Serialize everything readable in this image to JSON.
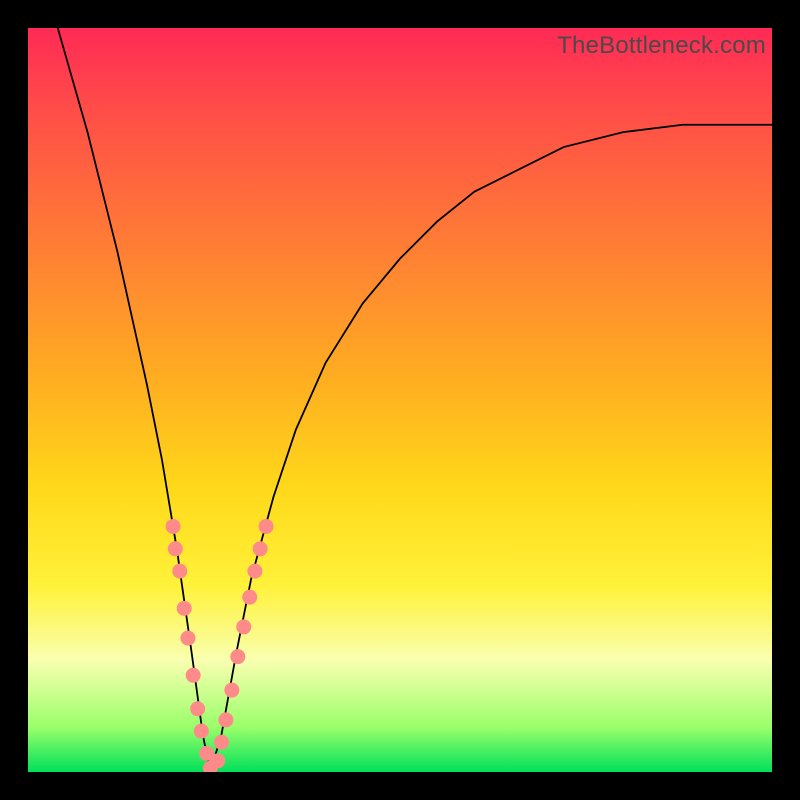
{
  "watermark": "TheBottleneck.com",
  "chart_data": {
    "type": "line",
    "title": "",
    "xlabel": "",
    "ylabel": "",
    "xlim": [
      0,
      1
    ],
    "ylim": [
      0,
      1
    ],
    "curve": {
      "name": "bottleneck-curve",
      "color": "#000000",
      "x": [
        0.04,
        0.06,
        0.08,
        0.1,
        0.12,
        0.14,
        0.16,
        0.18,
        0.2,
        0.22,
        0.235,
        0.245,
        0.26,
        0.28,
        0.3,
        0.33,
        0.36,
        0.4,
        0.45,
        0.5,
        0.55,
        0.6,
        0.66,
        0.72,
        0.8,
        0.88,
        0.96,
        1.0
      ],
      "y": [
        1.0,
        0.93,
        0.86,
        0.78,
        0.7,
        0.61,
        0.52,
        0.42,
        0.3,
        0.16,
        0.05,
        0.0,
        0.05,
        0.16,
        0.26,
        0.37,
        0.46,
        0.55,
        0.63,
        0.69,
        0.74,
        0.78,
        0.81,
        0.84,
        0.86,
        0.87,
        0.87,
        0.87
      ]
    },
    "marker_clusters": [
      {
        "name": "left-markers",
        "color": "#ff8a8a",
        "points": [
          {
            "x": 0.195,
            "y": 0.33
          },
          {
            "x": 0.198,
            "y": 0.3
          },
          {
            "x": 0.204,
            "y": 0.27
          },
          {
            "x": 0.21,
            "y": 0.22
          },
          {
            "x": 0.215,
            "y": 0.18
          },
          {
            "x": 0.222,
            "y": 0.13
          },
          {
            "x": 0.228,
            "y": 0.085
          },
          {
            "x": 0.233,
            "y": 0.055
          },
          {
            "x": 0.24,
            "y": 0.025
          },
          {
            "x": 0.245,
            "y": 0.005
          }
        ]
      },
      {
        "name": "right-markers",
        "color": "#ff8a8a",
        "points": [
          {
            "x": 0.255,
            "y": 0.015
          },
          {
            "x": 0.26,
            "y": 0.04
          },
          {
            "x": 0.266,
            "y": 0.07
          },
          {
            "x": 0.274,
            "y": 0.11
          },
          {
            "x": 0.282,
            "y": 0.155
          },
          {
            "x": 0.29,
            "y": 0.195
          },
          {
            "x": 0.298,
            "y": 0.235
          },
          {
            "x": 0.305,
            "y": 0.27
          },
          {
            "x": 0.312,
            "y": 0.3
          },
          {
            "x": 0.32,
            "y": 0.33
          }
        ]
      }
    ],
    "minimum_x": 0.245
  }
}
